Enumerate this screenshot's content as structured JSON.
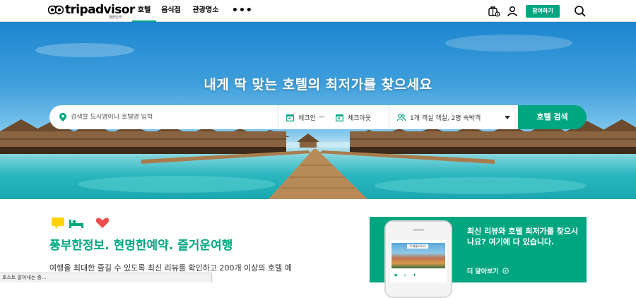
{
  "header": {
    "logo_text": "tripadvisor",
    "logo_sub": "대한민국",
    "tabs": [
      {
        "label": "호텔",
        "active": true
      },
      {
        "label": "음식점",
        "active": false
      },
      {
        "label": "관광명소",
        "active": false
      }
    ],
    "more_label": "•••",
    "join_label": "참여하기",
    "icons": [
      "suitcase-icon",
      "user-icon",
      "search-icon"
    ]
  },
  "hero": {
    "title": "내게 딱 맞는 호텔의 최저가를 찾으세요",
    "search_placeholder": "검색할 도시명이나 호텔명 입력",
    "checkin_label": "체크인",
    "dash": "—",
    "checkout_label": "체크아웃",
    "guests_label": "1개 객실 객실, 2명 숙박객",
    "search_button": "호텔 검색"
  },
  "content": {
    "tagline": "풍부한정보. 현명한예약. 즐거운여행",
    "description": "여행을 최대한 즐길 수 있도록 최신 리뷰를 확인하고 200개 이상의 호텔 예"
  },
  "promo": {
    "text": "최신 리뷰와 호텔 최저가를 찾으시나요? 여기에 다 있습니다.",
    "link_label": "더 알아보기",
    "phone_badge": "트래블스토리"
  },
  "status_bar": {
    "text": "호스트 알아내는 중..."
  },
  "colors": {
    "brand_green": "#00a680"
  }
}
